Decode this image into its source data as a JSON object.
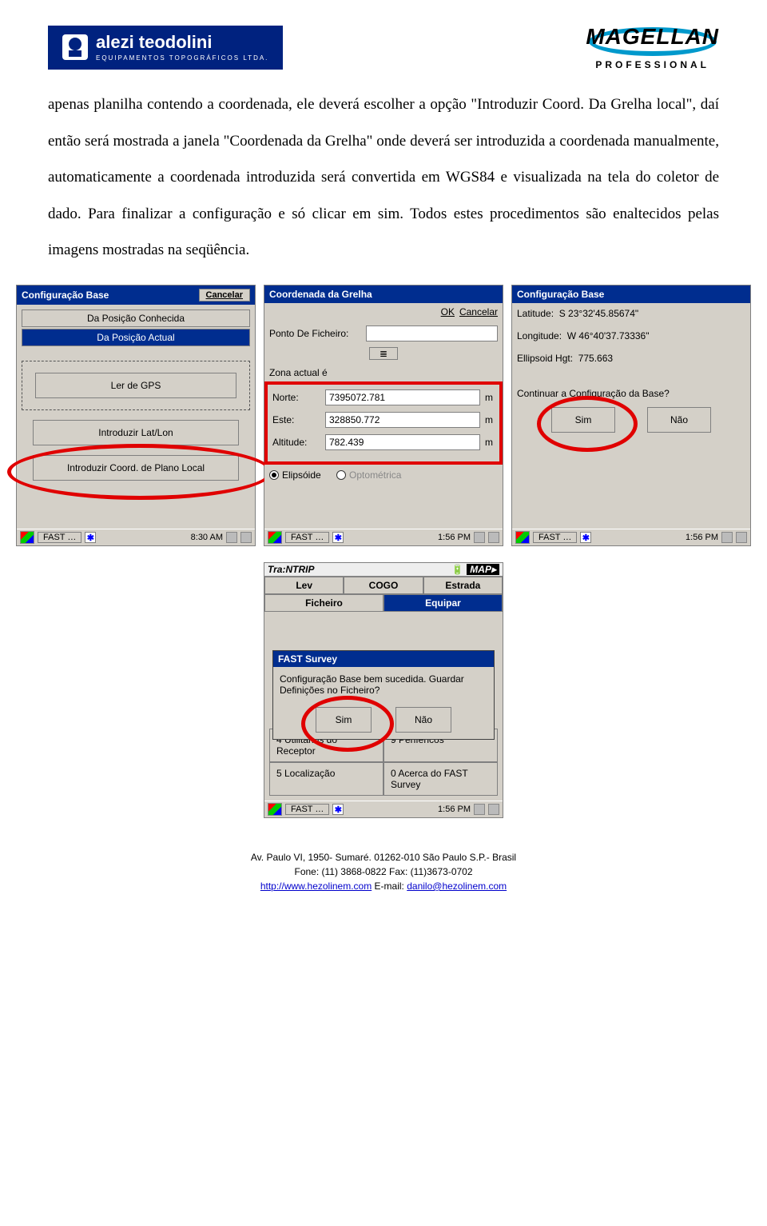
{
  "logos": {
    "left_main": "alezi teodolini",
    "left_sub": "EQUIPAMENTOS TOPOGRÁFICOS LTDA.",
    "right_main": "MAGELLAN",
    "right_sub": "PROFESSIONAL"
  },
  "paragraph": "apenas planilha contendo a coordenada, ele deverá escolher a opção \"Introduzir Coord. Da Grelha local\", daí então será mostrada a janela \"Coordenada da Grelha\" onde deverá ser introduzida a coordenada manualmente, automaticamente a coordenada introduzida será convertida em WGS84 e visualizada na tela do coletor de dado. Para finalizar a configuração e só clicar em sim. Todos estes procedimentos são enaltecidos pelas imagens mostradas na seqüência.",
  "shot1": {
    "title": "Configuração Base",
    "cancel": "Cancelar",
    "tab_known": "Da Posição Conhecida",
    "tab_current": "Da Posição Actual",
    "btn_read_gps": "Ler de GPS",
    "btn_latlon": "Introduzir Lat/Lon",
    "btn_grid": "Introduzir Coord. de Plano Local",
    "taskbar_app": "FAST …",
    "time": "8:30 AM"
  },
  "shot2": {
    "title": "Coordenada da Grelha",
    "ok": "OK",
    "cancel": "Cancelar",
    "file_point_label": "Ponto De Ficheiro:",
    "zone_label": "Zona actual é",
    "north_label": "Norte:",
    "north_val": "7395072.781",
    "east_label": "Este:",
    "east_val": "328850.772",
    "alt_label": "Altitude:",
    "alt_val": "782.439",
    "unit": "m",
    "radio_ellipsoid": "Elipsóide",
    "radio_ortho": "Optométrica",
    "taskbar_app": "FAST …",
    "time": "1:56 PM"
  },
  "shot3": {
    "title": "Configuração Base",
    "lat_label": "Latitude:",
    "lat_val": "S 23°32'45.85674\"",
    "lon_label": "Longitude:",
    "lon_val": "W 46°40'37.73336\"",
    "hgt_label": "Ellipsoid Hgt:",
    "hgt_val": "775.663",
    "question": "Continuar a Configuração da Base?",
    "yes": "Sim",
    "no": "Não",
    "taskbar_app": "FAST …",
    "time": "1:56 PM"
  },
  "shot4": {
    "status_left": "Tra:NTRIP",
    "status_right": "MAP▸",
    "tab_lev": "Lev",
    "tab_cogo": "COGO",
    "tab_estrada": "Estrada",
    "tab_fich": "Ficheiro",
    "tab_equip": "Equipar",
    "dlg_title": "FAST Survey",
    "dlg_text": "Configuração Base bem sucedida. Guardar Definições no Ficheiro?",
    "yes": "Sim",
    "no": "Não",
    "back_item1_left": "4 Utilitários do Receptor",
    "back_item1_right": "9 Periféricos",
    "back_item2_left": "5 Localização",
    "back_item2_right": "0 Acerca do FAST Survey",
    "taskbar_app": "FAST …",
    "time": "1:56 PM"
  },
  "footer": {
    "addr": "Av. Paulo VI, 1950- Sumaré.  01262-010   São Paulo  S.P.- Brasil",
    "phones": "Fone: (11) 3868-0822  Fax: (11)3673-0702",
    "site": "http://www.hezolinem.com",
    "mail_prefix": " E-mail: ",
    "mail": "danilo@hezolinem.com"
  }
}
